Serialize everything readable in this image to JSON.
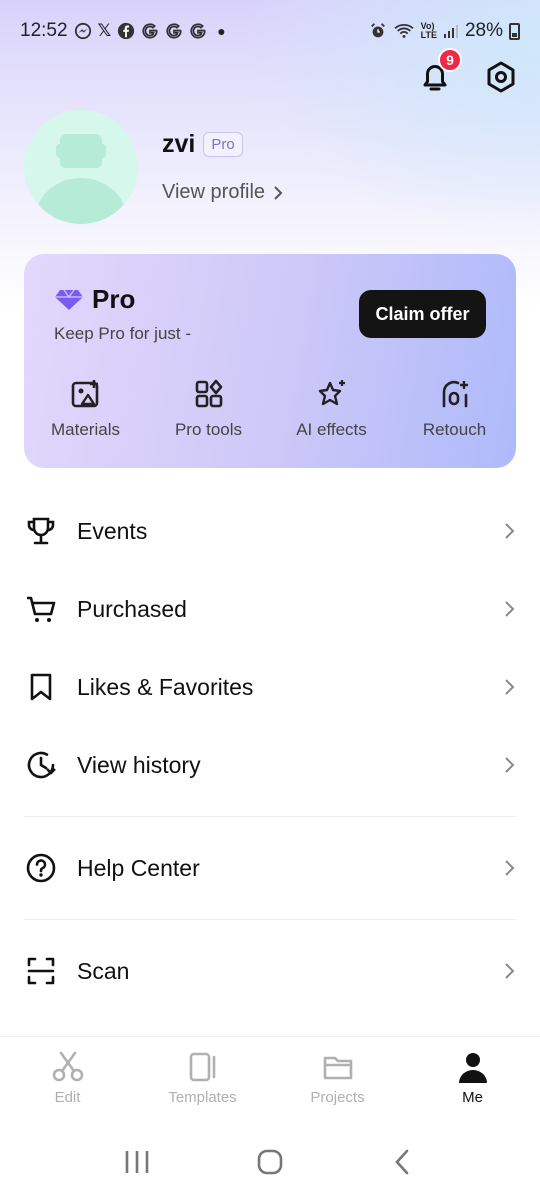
{
  "status": {
    "time": "12:52",
    "battery": "28%",
    "app_icons": [
      "messenger-icon",
      "x-icon",
      "facebook-icon",
      "g-icon",
      "g-icon",
      "g-icon"
    ]
  },
  "notifications": {
    "count": "9"
  },
  "profile": {
    "username": "zvi",
    "badge": "Pro",
    "view_profile": "View profile"
  },
  "pro_card": {
    "title": "Pro",
    "subtitle": "Keep Pro for just -",
    "claim_button": "Claim offer",
    "features": [
      {
        "label": "Materials",
        "icon": "image-plus-icon"
      },
      {
        "label": "Pro tools",
        "icon": "grid-tools-icon"
      },
      {
        "label": "AI effects",
        "icon": "sparkle-icon"
      },
      {
        "label": "Retouch",
        "icon": "face-retouch-icon"
      }
    ]
  },
  "menu": [
    {
      "label": "Events",
      "icon": "trophy-icon"
    },
    {
      "label": "Purchased",
      "icon": "cart-icon"
    },
    {
      "label": "Likes & Favorites",
      "icon": "bookmark-icon"
    },
    {
      "label": "View history",
      "icon": "history-icon"
    },
    {
      "label": "Help Center",
      "icon": "help-icon"
    },
    {
      "label": "Scan",
      "icon": "scan-icon"
    }
  ],
  "tabs": [
    {
      "label": "Edit",
      "icon": "scissors-icon",
      "active": false
    },
    {
      "label": "Templates",
      "icon": "templates-icon",
      "active": false
    },
    {
      "label": "Projects",
      "icon": "folder-icon",
      "active": false
    },
    {
      "label": "Me",
      "icon": "person-icon",
      "active": true
    }
  ],
  "colors": {
    "accent": "#f02846",
    "card_start": "#e2d8fc",
    "card_end": "#aebafa"
  }
}
